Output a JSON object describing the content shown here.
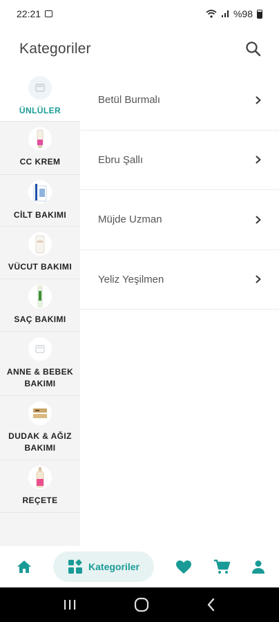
{
  "status": {
    "time": "22:21",
    "battery": "%98"
  },
  "header": {
    "title": "Kategoriler"
  },
  "sidebar": {
    "items": [
      {
        "label": "ÜNLÜLER",
        "active": true
      },
      {
        "label": "CC KREM"
      },
      {
        "label": "CİLT BAKIMI"
      },
      {
        "label": "VÜCUT BAKIMI"
      },
      {
        "label": "SAÇ BAKIMI"
      },
      {
        "label": "ANNE & BEBEK BAKIMI"
      },
      {
        "label": "DUDAK & AĞIZ BAKIMI"
      },
      {
        "label": "REÇETE"
      }
    ]
  },
  "list": {
    "items": [
      {
        "label": "Betül Burmalı"
      },
      {
        "label": "Ebru Şallı"
      },
      {
        "label": "Müjde Uzman"
      },
      {
        "label": "Yeliz Yeşilmen"
      }
    ]
  },
  "bottom_nav": {
    "categories_label": "Kategoriler"
  },
  "colors": {
    "accent": "#1a9a96",
    "pill_bg": "#e7f3f2",
    "sidebar_bg": "#f4f4f4"
  },
  "icons": [
    "search-icon",
    "chevron-right-icon",
    "home-icon",
    "categories-icon",
    "heart-icon",
    "cart-icon",
    "user-icon"
  ]
}
